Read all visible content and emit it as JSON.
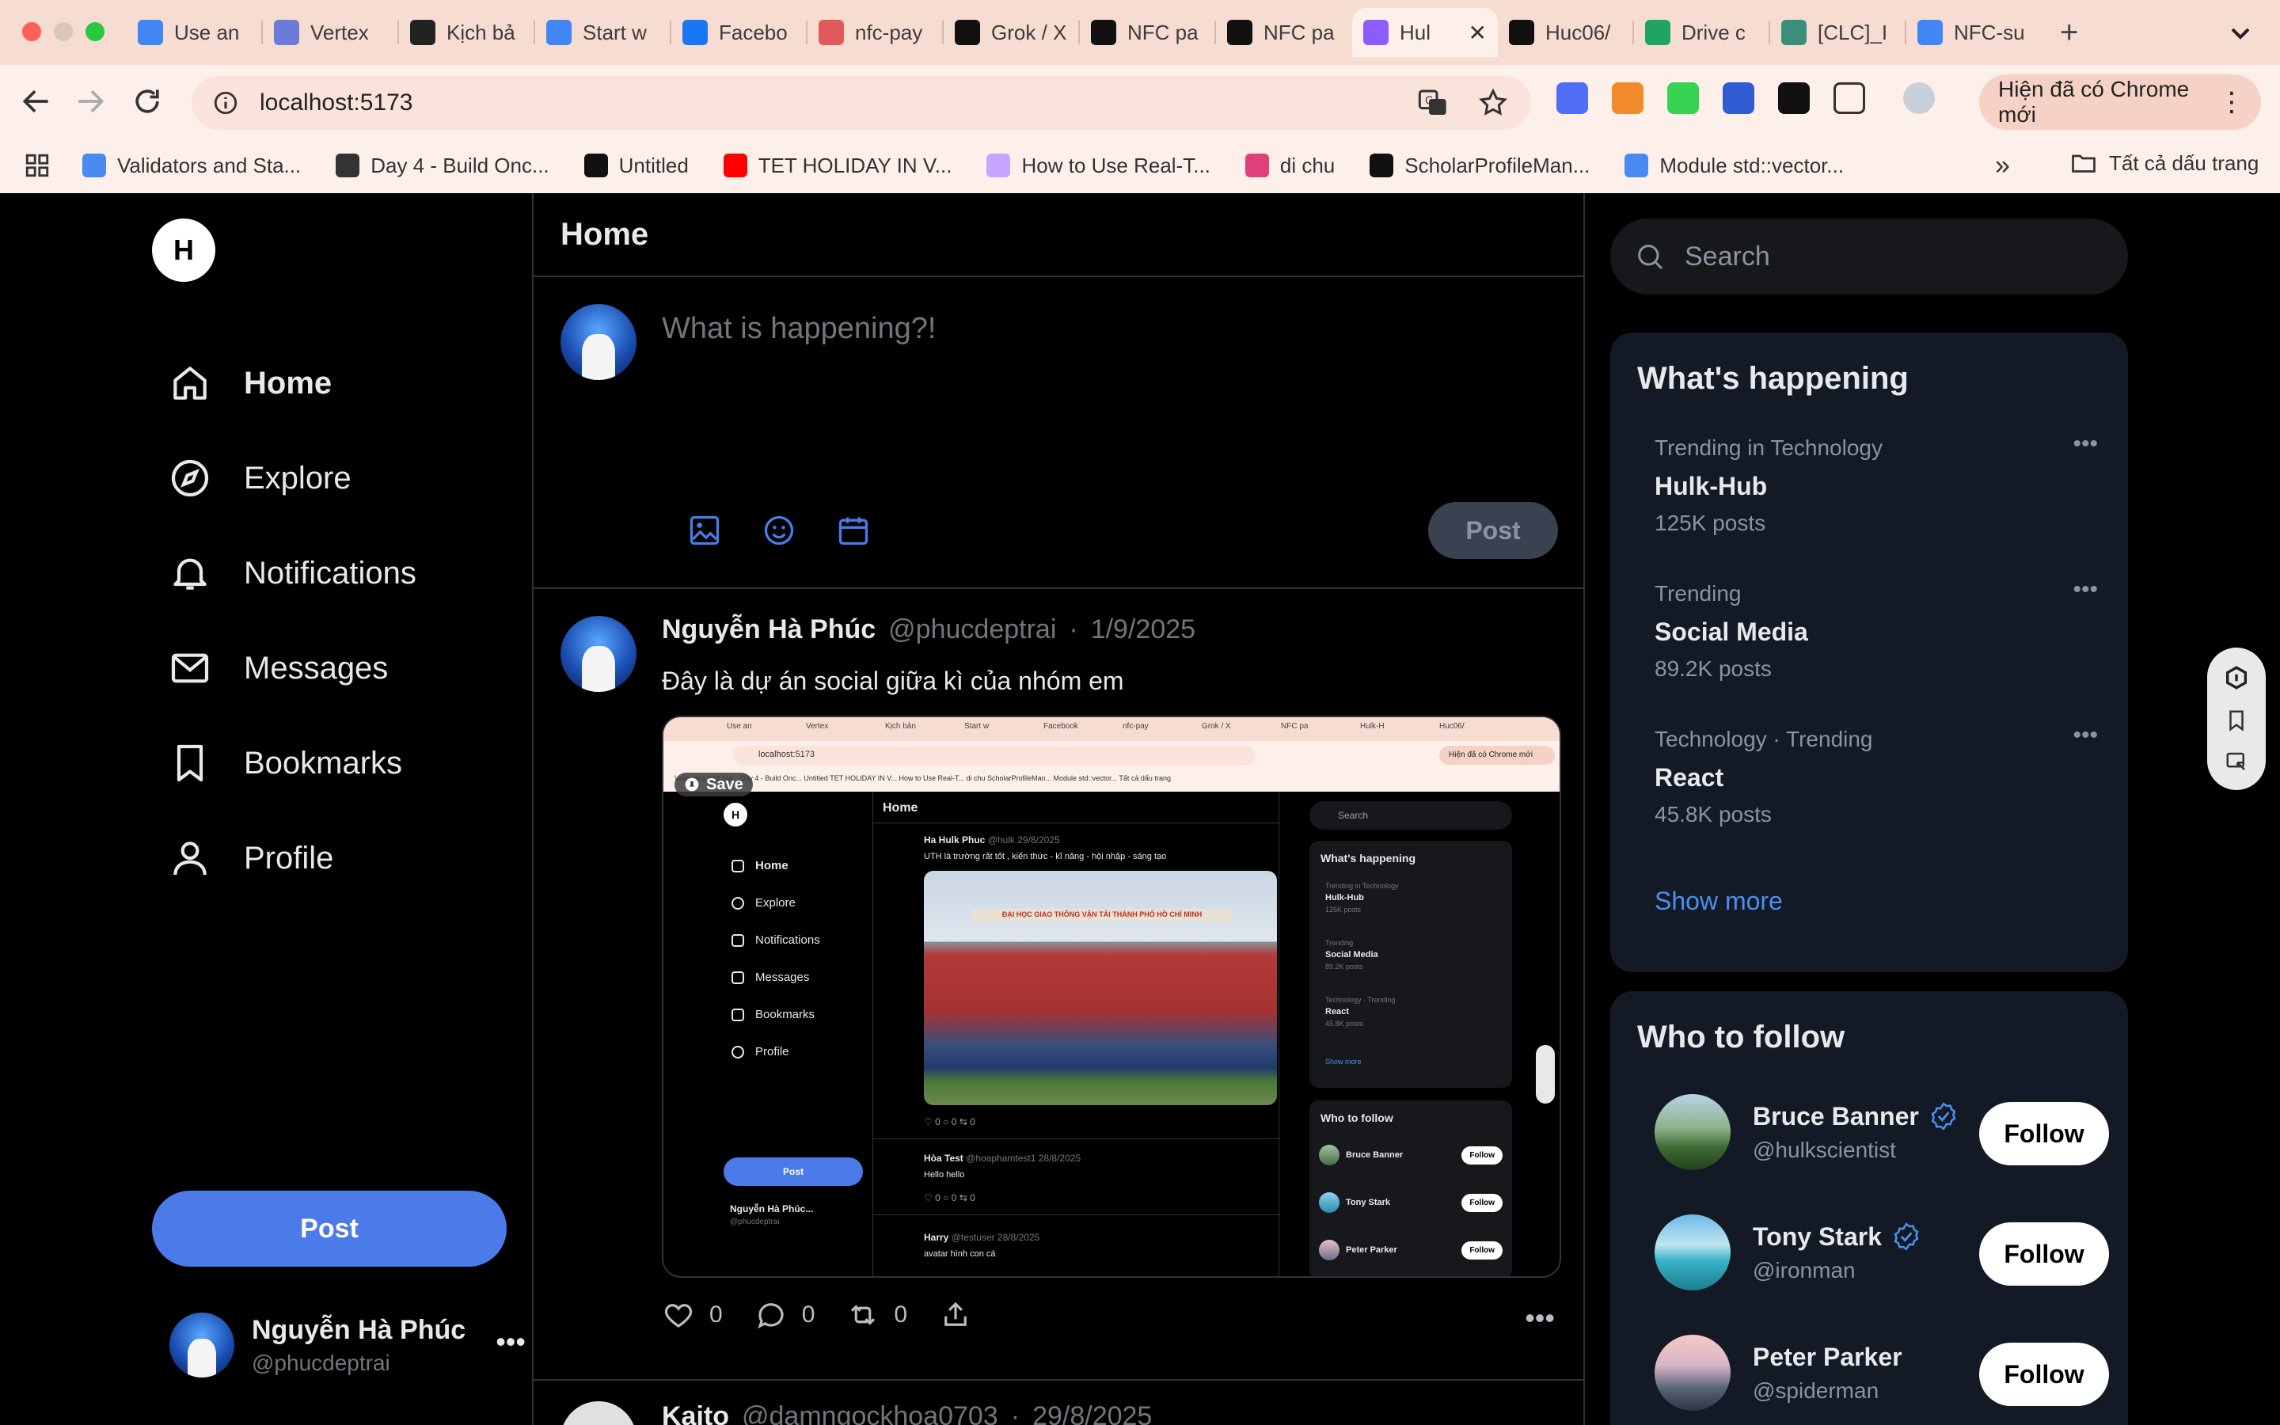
{
  "browser": {
    "tabs": [
      {
        "title": "Use an",
        "color": "#4285f4"
      },
      {
        "title": "Vertex",
        "color": "#6a7bd8"
      },
      {
        "title": "Kịch bả",
        "color": "#222222"
      },
      {
        "title": "Start w",
        "color": "#4285f4"
      },
      {
        "title": "Facebo",
        "color": "#1877f2"
      },
      {
        "title": "nfc-pay",
        "color": "#e05a5a"
      },
      {
        "title": "Grok / X",
        "color": "#111111"
      },
      {
        "title": "NFC pa",
        "color": "#111111"
      },
      {
        "title": "NFC pa",
        "color": "#111111"
      },
      {
        "title": "Hul",
        "color": "#8c5cff",
        "active": true
      },
      {
        "title": "Huc06/",
        "color": "#111111"
      },
      {
        "title": "Drive c",
        "color": "#1fa463"
      },
      {
        "title": "[CLC]_I",
        "color": "#3a8f7a"
      },
      {
        "title": "NFC-su",
        "color": "#4285f4"
      }
    ],
    "url": "localhost:5173",
    "update_label": "Hiện đã có Chrome mới",
    "bookmarks": [
      {
        "title": "Validators and Sta...",
        "color": "#4a8af0"
      },
      {
        "title": "Day 4 - Build Onc...",
        "color": "#333333"
      },
      {
        "title": "Untitled",
        "color": "#111111"
      },
      {
        "title": "TET HOLIDAY IN V...",
        "color": "#ff0000"
      },
      {
        "title": "How to Use Real-T...",
        "color": "#c7a6ff"
      },
      {
        "title": "di chu",
        "color": "#e0407a"
      },
      {
        "title": "ScholarProfileMan...",
        "color": "#111111"
      },
      {
        "title": "Module std::vector...",
        "color": "#4a8af0"
      }
    ],
    "all_bookmarks": "Tất cả dấu trang"
  },
  "sidebar": {
    "logo": "H",
    "nav": [
      {
        "label": "Home",
        "icon": "home-icon",
        "active": true
      },
      {
        "label": "Explore",
        "icon": "compass-icon"
      },
      {
        "label": "Notifications",
        "icon": "bell-icon"
      },
      {
        "label": "Messages",
        "icon": "mail-icon"
      },
      {
        "label": "Bookmarks",
        "icon": "bookmark-icon"
      },
      {
        "label": "Profile",
        "icon": "user-icon"
      }
    ],
    "post_label": "Post",
    "user": {
      "name": "Nguyễn Hà Phúc",
      "handle": "@phucdeptrai"
    }
  },
  "center": {
    "title": "Home",
    "composer": {
      "placeholder": "What is happening?!",
      "post_label": "Post"
    },
    "tweet": {
      "name": "Nguyễn Hà Phúc",
      "handle": "@phucdeptrai",
      "date": "1/9/2025",
      "text": "Đây là dự án social giữa kì của nhóm em",
      "likes": "0",
      "replies": "0",
      "retweets": "0"
    },
    "tweet2": {
      "name": "Kaito",
      "handle": "@damngockhoa0703",
      "date": "29/8/2025"
    }
  },
  "media": {
    "save_label": "Save",
    "tabs": [
      "Use an",
      "Vertex",
      "Kịch bản",
      "Start w",
      "Facebook",
      "nfc-pay",
      "Grok / X",
      "NFC pa",
      "Hulk-H",
      "Huc06/"
    ],
    "url": "localhost:5173",
    "update": "Hiện đã có Chrome mới",
    "bookmarks": "Validators and Sta...   Day 4 - Build Onc...   Untitled   TET HOLIDAY IN V...   How to Use Real-T...   di chu   ScholarProfileMan...   Module std::vector...   Tất cả dấu trang",
    "logo": "H",
    "nav": [
      "Home",
      "Explore",
      "Notifications",
      "Messages",
      "Bookmarks",
      "Profile"
    ],
    "post": "Post",
    "user_name": "Nguyễn Hà Phúc...",
    "user_handle": "@phucdeptrai",
    "home": "Home",
    "tweet1": {
      "name": "Ha Hulk Phuc",
      "handle": "@hulk",
      "date": "29/8/2025",
      "text": "UTH là trường rất tốt , kiến thức - kĩ năng - hội nhập - sáng tạo"
    },
    "banner": "ĐẠI HỌC GIAO THÔNG VẬN TẢI THÀNH PHỐ HỒ CHÍ MINH",
    "counts": "♡ 0    ○ 0    ⇆ 0",
    "tweet2": {
      "name": "Hòa Test",
      "handle": "@hoaphamtest1",
      "date": "28/8/2025",
      "text": "Hello hello"
    },
    "tweet3": {
      "name": "Harry",
      "handle": "@testuser",
      "date": "28/8/2025",
      "text": "avatar hình con cá"
    },
    "search": "Search",
    "whats": "What's happening",
    "trends": [
      {
        "cat": "Trending in Technology",
        "title": "Hulk-Hub",
        "count": "125K posts"
      },
      {
        "cat": "Trending",
        "title": "Social Media",
        "count": "89.2K posts"
      },
      {
        "cat": "Technology · Trending",
        "title": "React",
        "count": "45.8K posts"
      }
    ],
    "show_more": "Show more",
    "who": "Who to follow",
    "follows": [
      {
        "name": "Bruce Banner",
        "handle": "@hulkscientist"
      },
      {
        "name": "Tony Stark",
        "handle": "@ironman"
      },
      {
        "name": "Peter Parker",
        "handle": "@spiderman"
      }
    ],
    "follow": "Follow"
  },
  "right": {
    "search_placeholder": "Search",
    "whats_happening": "What's happening",
    "trends": [
      {
        "category": "Trending in Technology",
        "title": "Hulk-Hub",
        "count": "125K posts"
      },
      {
        "category": "Trending",
        "title": "Social Media",
        "count": "89.2K posts"
      },
      {
        "category": "Technology · Trending",
        "title": "React",
        "count": "45.8K posts"
      }
    ],
    "show_more": "Show more",
    "who_to_follow": "Who to follow",
    "follows": [
      {
        "name": "Bruce Banner",
        "handle": "@hulkscientist",
        "verified": true,
        "avatar": "mountain"
      },
      {
        "name": "Tony Stark",
        "handle": "@ironman",
        "verified": true,
        "avatar": "beach"
      },
      {
        "name": "Peter Parker",
        "handle": "@spiderman",
        "verified": false,
        "avatar": "sunset"
      }
    ],
    "follow_label": "Follow"
  },
  "colors": {
    "accent": "#4a7be8",
    "link": "#4a90f0",
    "verified": "#4a90f0"
  }
}
